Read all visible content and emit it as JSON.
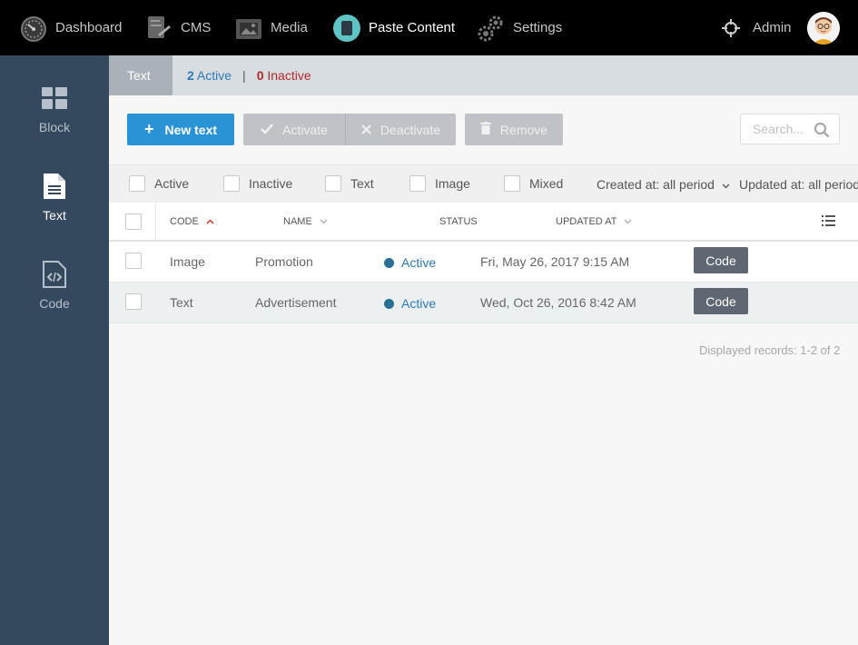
{
  "topnav": {
    "items": [
      {
        "label": "Dashboard",
        "icon": "speedometer-icon",
        "active": false
      },
      {
        "label": "CMS",
        "icon": "cms-icon",
        "active": false
      },
      {
        "label": "Media",
        "icon": "media-icon",
        "active": false
      },
      {
        "label": "Paste Content",
        "icon": "paste-content-icon",
        "active": true
      },
      {
        "label": "Settings",
        "icon": "gears-icon",
        "active": false
      }
    ],
    "user": {
      "label": "Admin",
      "icon": "crosshair-icon"
    }
  },
  "sidebar": {
    "items": [
      {
        "label": "Block",
        "icon": "grid-icon",
        "active": false
      },
      {
        "label": "Text",
        "icon": "document-icon",
        "active": true
      },
      {
        "label": "Code",
        "icon": "code-file-icon",
        "active": false
      }
    ]
  },
  "breadcrumb": {
    "tab": "Text",
    "active_count": "2",
    "active_label": "Active",
    "separator": "|",
    "inactive_count": "0",
    "inactive_label": "Inactive"
  },
  "toolbar": {
    "new_label": "New text",
    "activate_label": "Activate",
    "deactivate_label": "Deactivate",
    "remove_label": "Remove",
    "search_placeholder": "Search..."
  },
  "filters": {
    "checkboxes": [
      "Active",
      "Inactive",
      "Text",
      "Image",
      "Mixed"
    ],
    "created": "Created at: all period",
    "updated": "Updated at: all period"
  },
  "table": {
    "columns": [
      "Code",
      "Name",
      "Status",
      "Updated at"
    ],
    "rows": [
      {
        "code": "Image",
        "name": "Promotion",
        "status": "Active",
        "updated": "Fri, May 26, 2017 9:15 AM",
        "action": "Code"
      },
      {
        "code": "Text",
        "name": "Advertisement",
        "status": "Active",
        "updated": "Wed, Oct 26, 2016 8:42 AM",
        "action": "Code"
      }
    ]
  },
  "footer": {
    "records": "Displayed records: 1-2 of 2"
  },
  "colors": {
    "accent": "#2a93d5",
    "active_status": "#2a7ab3",
    "inactive_status": "#b02a2a",
    "sidebar": "#34495e"
  }
}
